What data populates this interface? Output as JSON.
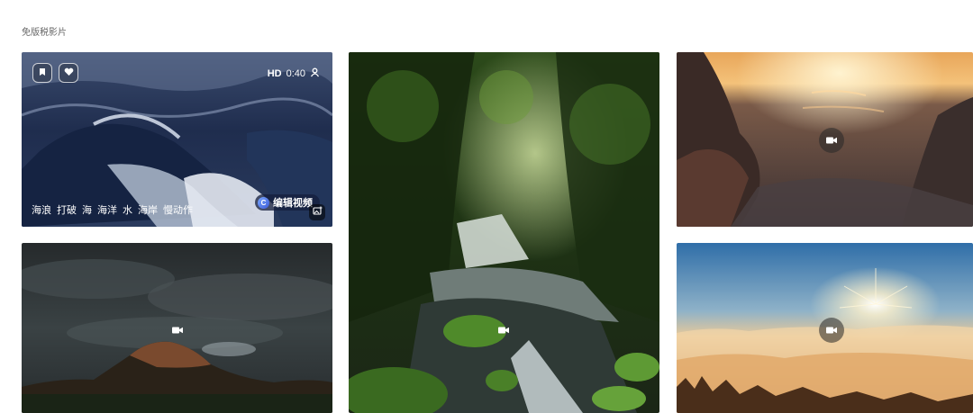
{
  "section": {
    "title": "免版税影片"
  },
  "featured": {
    "quality": "HD",
    "duration": "0:40",
    "tags": [
      "海浪",
      "打破",
      "海",
      "海洋",
      "水",
      "海岸",
      "慢动作"
    ],
    "edit_label": "编辑视频",
    "edit_logo": "C"
  },
  "icons": {
    "bookmark": "bookmark-icon",
    "like": "heart-icon",
    "model_release": "person-badge-icon",
    "add_to_board": "image-add-icon",
    "video": "video-camera-icon"
  },
  "tiles": [
    {
      "id": "ocean-wave",
      "featured": true
    },
    {
      "id": "forest-waterfall"
    },
    {
      "id": "rock-sunset-sea"
    },
    {
      "id": "storm-mountain"
    },
    {
      "id": "sea-of-clouds-sunrise"
    }
  ]
}
